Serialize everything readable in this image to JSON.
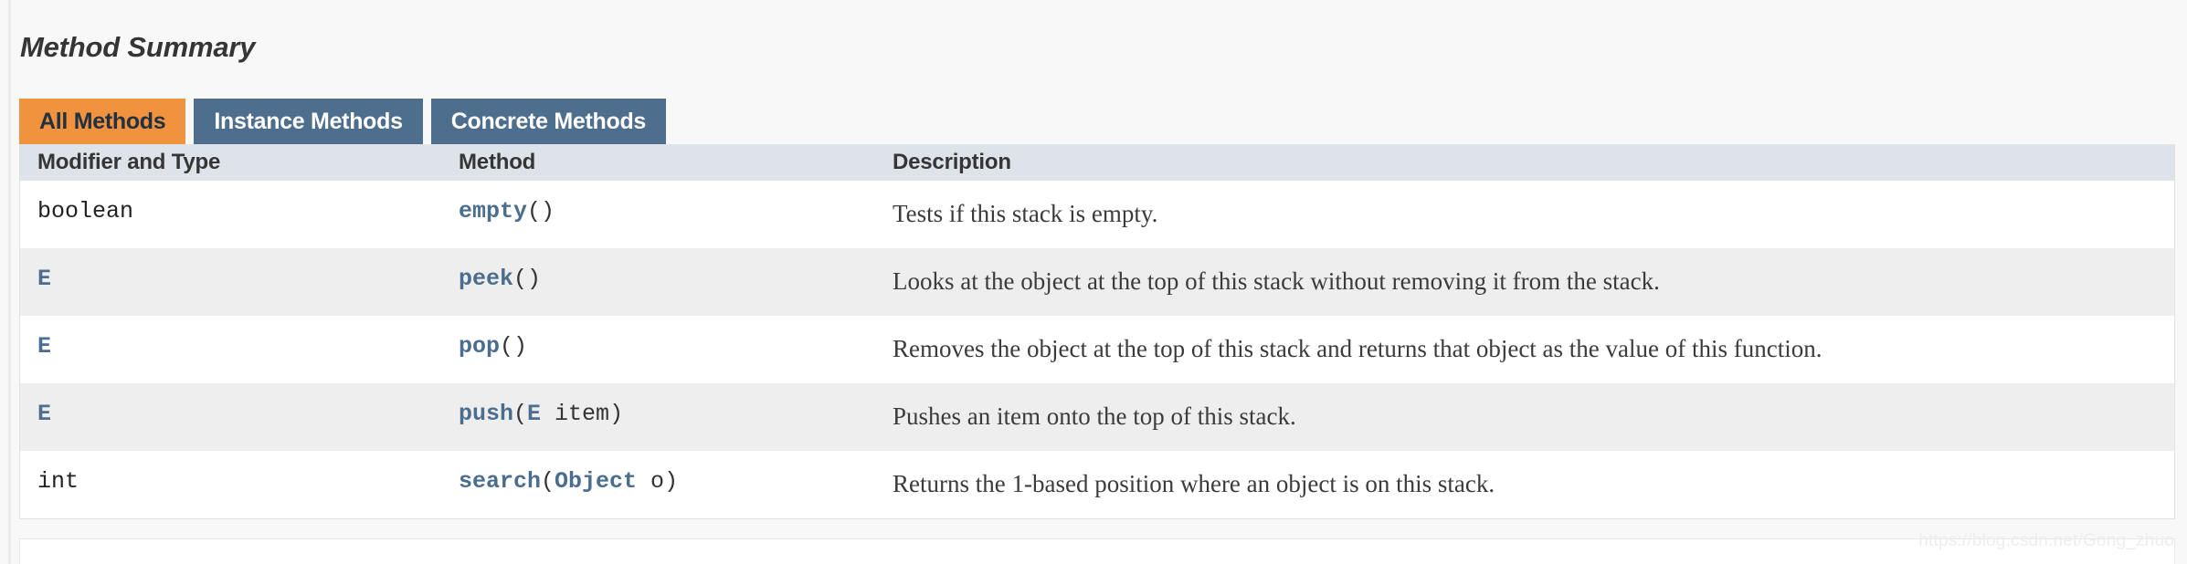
{
  "page": {
    "title": "Method Summary",
    "watermark": "https://blog.csdn.net/Gong_zhuo"
  },
  "colors": {
    "active_tab_bg": "#f0923e",
    "active_tab_text": "#22313f",
    "inactive_tab_bg": "#4e6e8e",
    "inactive_tab_text": "#ffffff",
    "table_header_bg": "#dee3e9",
    "row_alt_bg": "#eeeeee",
    "row_bg": "#ffffff",
    "link_color": "#4b6e8f",
    "page_bg": "#f8f8f8"
  },
  "tabs": [
    {
      "label": "All Methods",
      "active": true
    },
    {
      "label": "Instance Methods",
      "active": false
    },
    {
      "label": "Concrete Methods",
      "active": false
    }
  ],
  "table": {
    "headers": {
      "type": "Modifier and Type",
      "method": "Method",
      "description": "Description"
    },
    "rows": [
      {
        "type": "boolean",
        "type_is_link": false,
        "method_name": "empty",
        "params": [],
        "description": "Tests if this stack is empty."
      },
      {
        "type": "E",
        "type_is_link": true,
        "method_name": "peek",
        "params": [],
        "description": "Looks at the object at the top of this stack without removing it from the stack."
      },
      {
        "type": "E",
        "type_is_link": true,
        "method_name": "pop",
        "params": [],
        "description": "Removes the object at the top of this stack and returns that object as the value of this function."
      },
      {
        "type": "E",
        "type_is_link": true,
        "method_name": "push",
        "params": [
          {
            "ptype": "E",
            "pname": "item"
          }
        ],
        "description": "Pushes an item onto the top of this stack."
      },
      {
        "type": "int",
        "type_is_link": false,
        "method_name": "search",
        "params": [
          {
            "ptype": "Object",
            "pname": "o"
          }
        ],
        "description": "Returns the 1-based position where an object is on this stack."
      }
    ]
  }
}
